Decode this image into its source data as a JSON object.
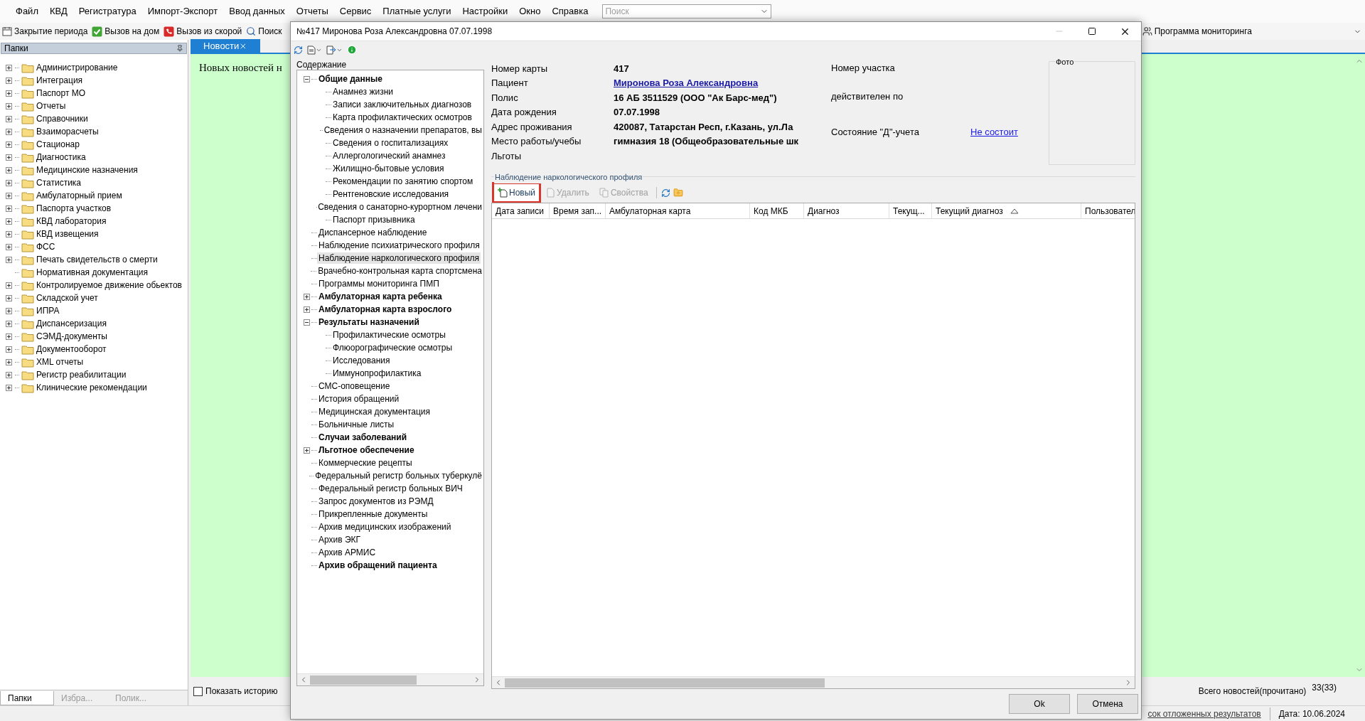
{
  "menu": [
    "Файл",
    "КВД",
    "Регистратура",
    "Импорт-Экспорт",
    "Ввод данных",
    "Отчеты",
    "Сервис",
    "Платные услуги",
    "Настройки",
    "Окно",
    "Справка"
  ],
  "search": {
    "placeholder": "Поиск"
  },
  "toolbar": [
    {
      "label": "Закрытие периода",
      "kind": "period"
    },
    {
      "label": "Вызов на дом",
      "kind": "home"
    },
    {
      "label": "Вызов из скорой",
      "kind": "ambulance"
    },
    {
      "label": "Поиск",
      "kind": "search"
    }
  ],
  "toolbar_right": {
    "label": "Программа мониторинга"
  },
  "folders_panel": {
    "title": "Папки",
    "items": [
      {
        "label": "Администрирование",
        "expandable": true
      },
      {
        "label": "Интеграция",
        "expandable": true
      },
      {
        "label": "Паспорт МО",
        "expandable": true
      },
      {
        "label": "Отчеты",
        "expandable": true
      },
      {
        "label": "Справочники",
        "expandable": true
      },
      {
        "label": "Взаиморасчеты",
        "expandable": true
      },
      {
        "label": "Стационар",
        "expandable": true
      },
      {
        "label": "Диагностика",
        "expandable": true
      },
      {
        "label": "Медицинские назначения",
        "expandable": true
      },
      {
        "label": "Статистика",
        "expandable": true
      },
      {
        "label": "Амбулаторный прием",
        "expandable": true
      },
      {
        "label": "Паспорта участков",
        "expandable": true
      },
      {
        "label": "КВД лаборатория",
        "expandable": true
      },
      {
        "label": "КВД извещения",
        "expandable": true
      },
      {
        "label": "ФСС",
        "expandable": true
      },
      {
        "label": "Печать свидетельств о смерти",
        "expandable": true
      },
      {
        "label": "Нормативная документация",
        "expandable": false
      },
      {
        "label": "Контролируемое движение обьектов",
        "expandable": true
      },
      {
        "label": "Складской учет",
        "expandable": true
      },
      {
        "label": "ИПРА",
        "expandable": true
      },
      {
        "label": "Диспансеризация",
        "expandable": true
      },
      {
        "label": "СЭМД-документы",
        "expandable": true
      },
      {
        "label": "Документооборот",
        "expandable": true
      },
      {
        "label": "XML отчеты",
        "expandable": true
      },
      {
        "label": "Регистр реабилитации",
        "expandable": true
      },
      {
        "label": "Клинические рекомендации",
        "expandable": true
      }
    ],
    "tabs": [
      {
        "label": "Папки",
        "selected": true
      },
      {
        "label": "Избра...",
        "selected": false
      },
      {
        "label": "Полик...",
        "selected": false
      }
    ]
  },
  "news": {
    "tab": "Новости",
    "message": "Новых новостей н",
    "show_history": {
      "label": "Показать историю",
      "checked": false
    },
    "total_label": "Всего новостей(прочитано)",
    "total_count": "33(33)"
  },
  "status_bar": {
    "link": "сок отложенных результатов",
    "date": "Дата: 10.06.2024"
  },
  "dialog": {
    "title": "№417 Миронова Роза Александровна 07.07.1998",
    "contents_label": "Содержание",
    "tree": [
      {
        "label": "Общие данные",
        "bold": true,
        "selected": false,
        "expanded": true,
        "children": [
          {
            "label": "Анамнез жизни",
            "bold": false,
            "selected": false
          },
          {
            "label": "Записи заключительных диагнозов",
            "bold": false,
            "selected": false
          },
          {
            "label": "Карта профилактических осмотров",
            "bold": false,
            "selected": false
          },
          {
            "label": "Сведения о назначении препаратов, вы",
            "bold": false,
            "selected": false
          },
          {
            "label": "Сведения о госпитализациях",
            "bold": false,
            "selected": false
          },
          {
            "label": "Аллергологический анамнез",
            "bold": false,
            "selected": false
          },
          {
            "label": "Жилищно-бытовые условия",
            "bold": false,
            "selected": false
          },
          {
            "label": "Рекомендации по занятию спортом",
            "bold": false,
            "selected": false
          },
          {
            "label": "Рентгеновские исследования",
            "bold": false,
            "selected": false
          },
          {
            "label": "Сведения о санаторно-курортном лечени",
            "bold": false,
            "selected": false
          },
          {
            "label": "Паспорт призывника",
            "bold": false,
            "selected": false
          }
        ]
      },
      {
        "label": "Диспансерное наблюдение",
        "bold": false,
        "selected": false
      },
      {
        "label": "Наблюдение психиатрического профиля",
        "bold": false,
        "selected": false
      },
      {
        "label": "Наблюдение наркологического профиля",
        "bold": false,
        "selected": true
      },
      {
        "label": "Врачебно-контрольная карта спортсмена",
        "bold": false,
        "selected": false
      },
      {
        "label": "Программы мониторинга ПМП",
        "bold": false,
        "selected": false
      },
      {
        "label": "Амбулаторная карта ребенка",
        "bold": true,
        "selected": false,
        "expanded": false
      },
      {
        "label": "Амбулаторная карта взрослого",
        "bold": true,
        "selected": false,
        "expanded": false
      },
      {
        "label": "Результаты назначений",
        "bold": true,
        "selected": false,
        "expanded": true,
        "children": [
          {
            "label": "Профилактические осмотры",
            "bold": false,
            "selected": false
          },
          {
            "label": "Флюорографические осмотры",
            "bold": false,
            "selected": false
          },
          {
            "label": "Исследования",
            "bold": false,
            "selected": false
          },
          {
            "label": "Иммунопрофилактика",
            "bold": false,
            "selected": false
          }
        ]
      },
      {
        "label": "СМС-оповещение",
        "bold": false,
        "selected": false
      },
      {
        "label": "История обращений",
        "bold": false,
        "selected": false
      },
      {
        "label": "Медицинская документация",
        "bold": false,
        "selected": false
      },
      {
        "label": "Больничные листы",
        "bold": false,
        "selected": false
      },
      {
        "label": "Случаи заболеваний",
        "bold": true,
        "selected": false
      },
      {
        "label": "Льготное обеспечение",
        "bold": true,
        "selected": false,
        "expanded": false
      },
      {
        "label": "Коммерческие рецепты",
        "bold": false,
        "selected": false
      },
      {
        "label": "Федеральный регистр больных туберкулё",
        "bold": false,
        "selected": false
      },
      {
        "label": "Федеральный регистр больных ВИЧ",
        "bold": false,
        "selected": false
      },
      {
        "label": "Запрос документов из РЭМД",
        "bold": false,
        "selected": false
      },
      {
        "label": "Прикрепленные документы",
        "bold": false,
        "selected": false
      },
      {
        "label": "Архив медицинских изображений",
        "bold": false,
        "selected": false
      },
      {
        "label": "Архив ЭКГ",
        "bold": false,
        "selected": false
      },
      {
        "label": "Архив АРМИС",
        "bold": false,
        "selected": false
      },
      {
        "label": "Архив обращений пациента",
        "bold": true,
        "selected": false
      }
    ],
    "info": {
      "left": [
        {
          "label": "Номер карты",
          "value": "417",
          "kind": "text"
        },
        {
          "label": "Пациент",
          "value": "Миронова Роза Александровна",
          "kind": "link"
        },
        {
          "label": "Полис",
          "value": "16 АБ 3511529 (ООО \"Ак Барс-мед\")",
          "kind": "text"
        },
        {
          "label": "Дата рождения",
          "value": "07.07.1998",
          "kind": "text"
        },
        {
          "label": "Адрес проживания",
          "value": "420087, Татарстан Респ, г.Казань, ул.Ла",
          "kind": "text"
        },
        {
          "label": "Место работы/учебы",
          "value": "гимназия 18 (Общеобразовательные шк",
          "kind": "text"
        },
        {
          "label": "Льготы"
        }
      ],
      "right": [
        {
          "label": "Номер участка"
        },
        {
          "label": "действителен по"
        },
        {
          "label": "Состояние \"Д\"-учета",
          "link": "Не состоит"
        }
      ],
      "photo_label": "Фото"
    },
    "section_title": "Наблюдение наркологического профиля",
    "actions": [
      {
        "label": "Новый",
        "kind": "new",
        "disabled": false,
        "highlighted": true
      },
      {
        "label": "Удалить",
        "kind": "delete",
        "disabled": true,
        "highlighted": false
      },
      {
        "label": "Свойства",
        "kind": "properties",
        "disabled": true,
        "highlighted": false
      }
    ],
    "columns": [
      {
        "label": "Дата записи",
        "sorted": false
      },
      {
        "label": "Время зап...",
        "sorted": false
      },
      {
        "label": "Амбулаторная карта",
        "sorted": false
      },
      {
        "label": "Код МКБ",
        "sorted": false
      },
      {
        "label": "Диагноз",
        "sorted": false
      },
      {
        "label": "Текущ...",
        "sorted": false
      },
      {
        "label": "Текущий диагноз",
        "sorted": true
      },
      {
        "label": "Пользовател",
        "sorted": false
      }
    ],
    "buttons": [
      "Ok",
      "Отмена"
    ]
  }
}
